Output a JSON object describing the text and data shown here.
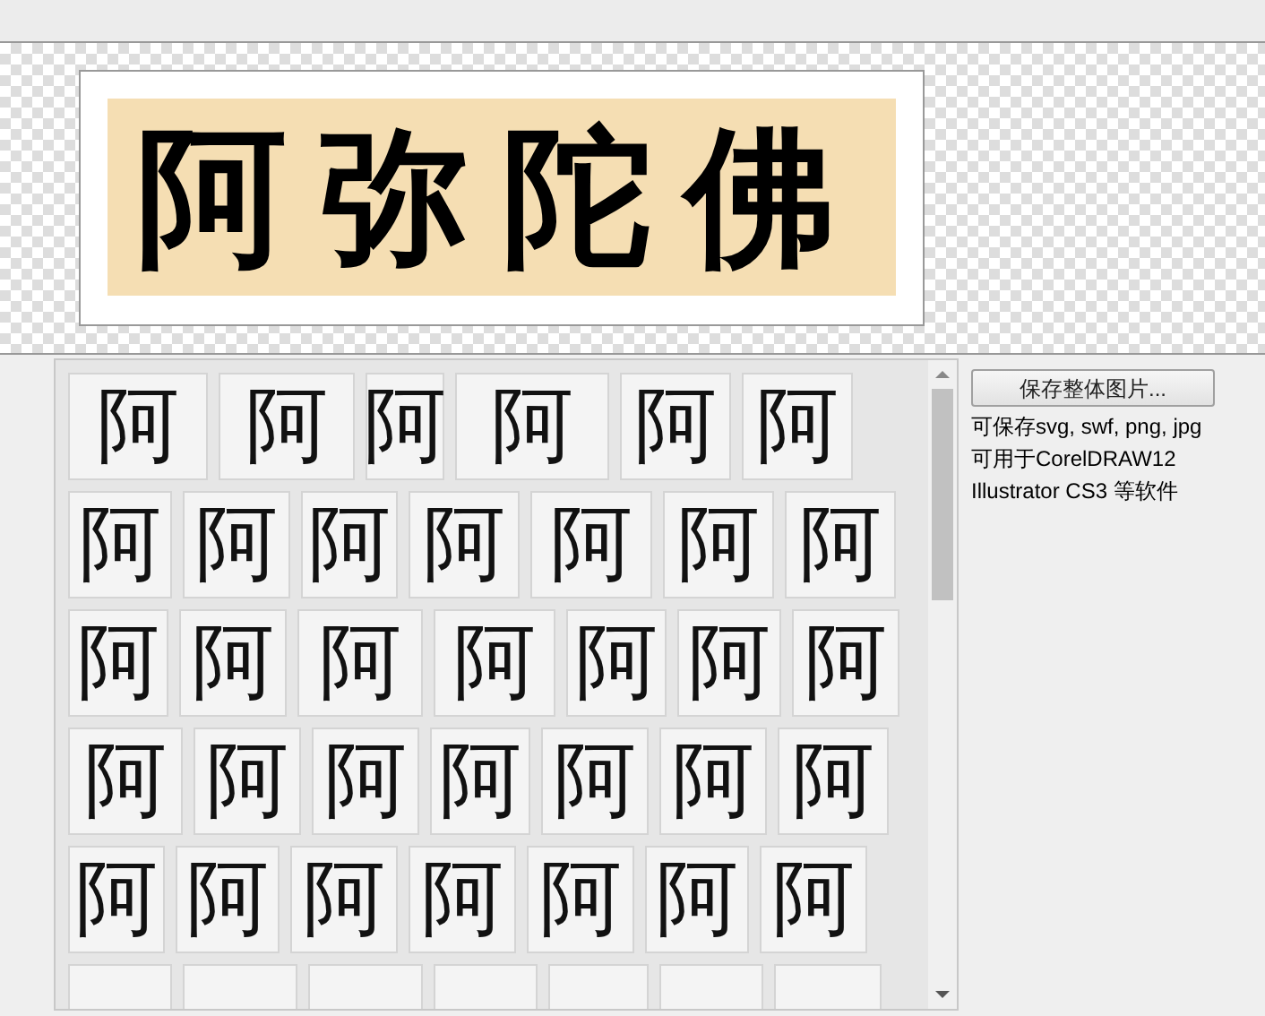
{
  "banner": {
    "text": "阿弥陀佛"
  },
  "glyph_grid": {
    "rows": [
      {
        "tiles": [
          {
            "kind": "glyph",
            "text": "阿"
          },
          {
            "kind": "glyph",
            "text": "阿"
          },
          {
            "kind": "glyph",
            "text": "阿"
          },
          {
            "kind": "glyph",
            "text": "阿"
          },
          {
            "kind": "glyph",
            "text": "阿"
          },
          {
            "kind": "glyph",
            "text": "阿"
          }
        ]
      },
      {
        "tiles": [
          {
            "kind": "glyph",
            "text": "阿"
          },
          {
            "kind": "glyph",
            "text": "阿"
          },
          {
            "kind": "glyph",
            "text": "阿"
          },
          {
            "kind": "glyph",
            "text": "阿"
          },
          {
            "kind": "glyph",
            "text": "阿"
          },
          {
            "kind": "glyph",
            "text": "阿"
          },
          {
            "kind": "glyph",
            "text": "阿"
          }
        ]
      },
      {
        "tiles": [
          {
            "kind": "glyph",
            "text": "阿"
          },
          {
            "kind": "glyph",
            "text": "阿"
          },
          {
            "kind": "glyph",
            "text": "阿"
          },
          {
            "kind": "glyph",
            "text": "阿"
          },
          {
            "kind": "glyph",
            "text": "阿"
          },
          {
            "kind": "glyph",
            "text": "阿"
          },
          {
            "kind": "glyph",
            "text": "阿"
          }
        ]
      },
      {
        "tiles": [
          {
            "kind": "glyph",
            "text": "阿"
          },
          {
            "kind": "glyph",
            "text": "阿"
          },
          {
            "kind": "glyph",
            "text": "阿"
          },
          {
            "kind": "glyph",
            "text": "阿"
          },
          {
            "kind": "glyph",
            "text": "阿"
          },
          {
            "kind": "glyph",
            "text": "阿"
          },
          {
            "kind": "glyph",
            "text": "阿"
          }
        ]
      },
      {
        "tiles": [
          {
            "kind": "glyph",
            "text": "阿"
          },
          {
            "kind": "glyph",
            "text": "阿"
          },
          {
            "kind": "glyph",
            "text": "阿"
          },
          {
            "kind": "glyph",
            "text": "阿"
          },
          {
            "kind": "glyph",
            "text": "阿"
          },
          {
            "kind": "glyph",
            "text": "阿"
          },
          {
            "kind": "glyph",
            "text": "阿"
          }
        ]
      },
      {
        "tiles": [
          {
            "kind": "cut"
          },
          {
            "kind": "cut"
          },
          {
            "kind": "cut"
          },
          {
            "kind": "cut"
          },
          {
            "kind": "cut"
          },
          {
            "kind": "cut"
          },
          {
            "kind": "cut"
          }
        ]
      }
    ]
  },
  "side_panel": {
    "button": "保存整体图片...",
    "notes": [
      "可保存svg, swf, png, jpg",
      "可用于CorelDRAW12",
      "Illustrator CS3 等软件"
    ]
  }
}
